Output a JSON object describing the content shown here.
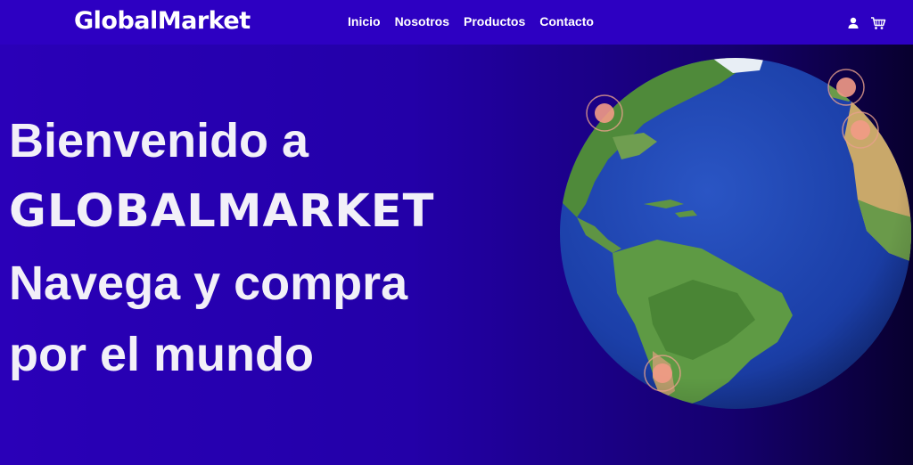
{
  "navbar": {
    "brand": "GlobalMarket",
    "links": [
      "Inicio",
      "Nosotros",
      "Productos",
      "Contacto"
    ],
    "icons": [
      "user-icon",
      "cart-icon"
    ]
  },
  "hero": {
    "line1": "Bienvenido a",
    "line2": "GLOBALMARKET",
    "line3": "Navega y compra",
    "line4": "por el mundo"
  },
  "globe": {
    "ocean_color": "#1b3fa8",
    "land_color": "#4f8a3a",
    "desert_color": "#c9a86a",
    "marker_color": "#f29a86",
    "markers": [
      "north-america-marker",
      "europe-marker",
      "north-africa-marker",
      "south-america-marker"
    ]
  },
  "colors": {
    "navbar": "#2d00c2",
    "background_start": "#2a00b8",
    "background_end": "#08002e",
    "text": "#ffffff"
  }
}
